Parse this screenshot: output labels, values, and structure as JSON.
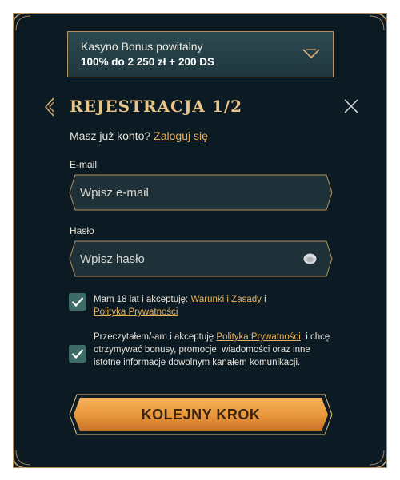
{
  "bonus": {
    "title": "Kasyno Bonus powitalny",
    "amount": "100% do 2 250 zł + 200 DS"
  },
  "header": {
    "title": "REJESTRACJA 1/2"
  },
  "login": {
    "prompt": "Masz już konto?",
    "link": "Zaloguj się"
  },
  "email": {
    "label": "E-mail",
    "placeholder": "Wpisz e-mail",
    "value": ""
  },
  "password": {
    "label": "Hasło",
    "placeholder": "Wpisz hasło",
    "value": ""
  },
  "consents": [
    {
      "checked": true,
      "text_before": "Mam 18 lat i akceptuję:",
      "link1": "Warunki i Zasady",
      "middle": "i",
      "link2": "Polityka Prywatności"
    },
    {
      "checked": true,
      "text_before": "Przeczytałem/-am i akceptuję",
      "link": "Polityka Prywatności",
      "text_after": ", i chcę otrzymywać bonusy, promocje, wiadomości oraz inne istotne informacje dowolnym kanałem komunikacji."
    }
  ],
  "cta": {
    "label": "KOLEJNY KROK"
  },
  "colors": {
    "background": "#0c1a24",
    "gold": "#e8c58a",
    "link": "#e6b25c",
    "checkbox": "#3d6b66",
    "cta_orange": "#e8953a"
  }
}
